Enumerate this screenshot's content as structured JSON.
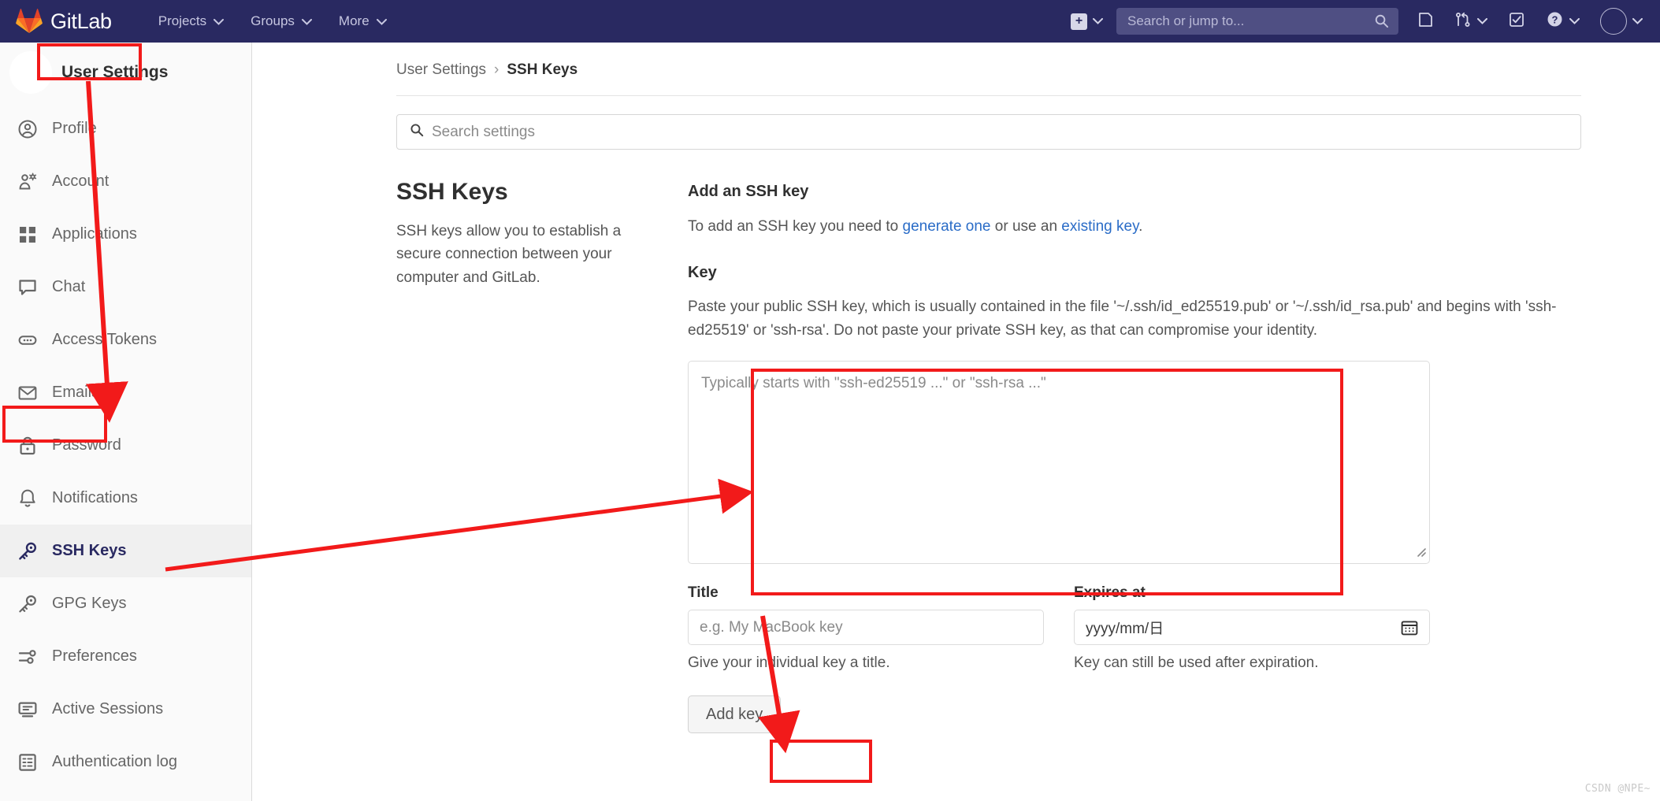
{
  "navbar": {
    "brand": "GitLab",
    "logo_icon": "gitlab-tanuki-logo",
    "menu": [
      {
        "label": "Projects",
        "icon": "chevron-down-icon"
      },
      {
        "label": "Groups",
        "icon": "chevron-down-icon"
      },
      {
        "label": "More",
        "icon": "chevron-down-icon"
      }
    ],
    "create_new": {
      "icon": "plus-square-icon",
      "glyph": "+",
      "chevron": "chevron-down-icon"
    },
    "search": {
      "placeholder": "Search or jump to...",
      "icon": "search-icon"
    },
    "right_icons": [
      {
        "name": "issues-icon"
      },
      {
        "name": "merge-requests-icon",
        "chevron": "chevron-down-icon"
      },
      {
        "name": "todos-icon"
      },
      {
        "name": "help-icon",
        "chevron": "chevron-down-icon"
      },
      {
        "name": "user-avatar",
        "chevron": "chevron-down-icon"
      }
    ],
    "bg_color": "#292961"
  },
  "sidebar": {
    "title": "User Settings",
    "avatar_icon": "user-avatar",
    "items": [
      {
        "label": "Profile",
        "icon": "profile-icon",
        "active": false
      },
      {
        "label": "Account",
        "icon": "account-icon",
        "active": false
      },
      {
        "label": "Applications",
        "icon": "applications-icon",
        "active": false
      },
      {
        "label": "Chat",
        "icon": "chat-icon",
        "active": false
      },
      {
        "label": "Access Tokens",
        "icon": "access-tokens-icon",
        "active": false
      },
      {
        "label": "Emails",
        "icon": "email-icon",
        "active": false
      },
      {
        "label": "Password",
        "icon": "lock-icon",
        "active": false
      },
      {
        "label": "Notifications",
        "icon": "bell-icon",
        "active": false
      },
      {
        "label": "SSH Keys",
        "icon": "key-icon",
        "active": true
      },
      {
        "label": "GPG Keys",
        "icon": "key-icon",
        "active": false
      },
      {
        "label": "Preferences",
        "icon": "preferences-icon",
        "active": false
      },
      {
        "label": "Active Sessions",
        "icon": "monitor-icon",
        "active": false
      },
      {
        "label": "Authentication log",
        "icon": "log-icon",
        "active": false
      }
    ]
  },
  "breadcrumb": {
    "parent": "User Settings",
    "separator": "›",
    "current": "SSH Keys"
  },
  "settings_search": {
    "placeholder": "Search settings",
    "icon": "search-icon"
  },
  "main": {
    "heading": "SSH Keys",
    "description": "SSH keys allow you to establish a secure connection between your computer and GitLab.",
    "add_heading": "Add an SSH key",
    "add_intro_pre": "To add an SSH key you need to ",
    "add_link_generate": "generate one",
    "add_intro_mid": " or use an ",
    "add_link_existing": "existing key",
    "add_intro_post": ".",
    "key_label": "Key",
    "key_help": "Paste your public SSH key, which is usually contained in the file '~/.ssh/id_ed25519.pub' or '~/.ssh/id_rsa.pub' and begins with 'ssh-ed25519' or 'ssh-rsa'. Do not paste your private SSH key, as that can compromise your identity.",
    "key_textarea": {
      "placeholder": "Typically starts with \"ssh-ed25519 ...\" or \"ssh-rsa ...\"",
      "value": "",
      "resize_handle_icon": "resize-grip-icon"
    },
    "title_field": {
      "label": "Title",
      "placeholder": "e.g. My MacBook key",
      "value": "",
      "help": "Give your individual key a title."
    },
    "expires_field": {
      "label": "Expires at",
      "placeholder": "yyyy/mm/日",
      "value": "",
      "help": "Key can still be used after expiration.",
      "icon": "calendar-icon"
    },
    "submit_label": "Add key"
  },
  "annotations": {
    "color": "#f21a1a",
    "boxes": [
      "User Settings",
      "SSH Keys",
      "key textarea",
      "Add key"
    ],
    "arrows": 3
  },
  "watermark": "CSDN @NPE~"
}
